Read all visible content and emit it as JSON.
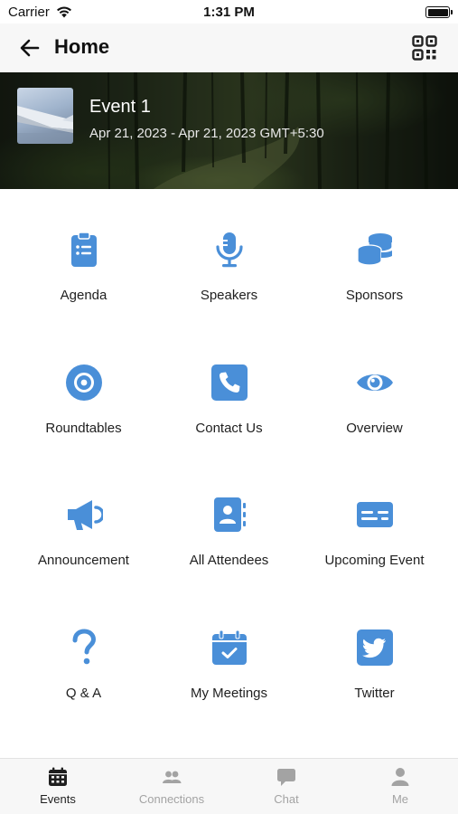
{
  "status_bar": {
    "carrier": "Carrier",
    "time": "1:31 PM"
  },
  "nav": {
    "title": "Home",
    "back_icon": "arrow-left-icon",
    "qr_icon": "qr-code-icon"
  },
  "event": {
    "title": "Event 1",
    "dates": "Apr 21, 2023 - Apr 21, 2023 GMT+5:30"
  },
  "accent_color": "#4a8fd8",
  "menu": [
    {
      "label": "Agenda",
      "icon": "clipboard-list-icon"
    },
    {
      "label": "Speakers",
      "icon": "microphone-icon"
    },
    {
      "label": "Sponsors",
      "icon": "coins-stack-icon"
    },
    {
      "label": "Roundtables",
      "icon": "target-circle-icon"
    },
    {
      "label": "Contact Us",
      "icon": "phone-square-icon"
    },
    {
      "label": "Overview",
      "icon": "eye-icon"
    },
    {
      "label": "Announcement",
      "icon": "megaphone-icon"
    },
    {
      "label": "All Attendees",
      "icon": "address-book-icon"
    },
    {
      "label": "Upcoming Event",
      "icon": "id-card-icon"
    },
    {
      "label": "Q & A",
      "icon": "question-mark-icon"
    },
    {
      "label": "My Meetings",
      "icon": "calendar-check-icon"
    },
    {
      "label": "Twitter",
      "icon": "twitter-icon"
    }
  ],
  "tabs": [
    {
      "label": "Events",
      "icon": "calendar-icon",
      "active": true
    },
    {
      "label": "Connections",
      "icon": "users-icon",
      "active": false
    },
    {
      "label": "Chat",
      "icon": "chat-bubble-icon",
      "active": false
    },
    {
      "label": "Me",
      "icon": "user-icon",
      "active": false
    }
  ],
  "tab_colors": {
    "active": "#1f1f1f",
    "inactive": "#a3a3a3"
  }
}
